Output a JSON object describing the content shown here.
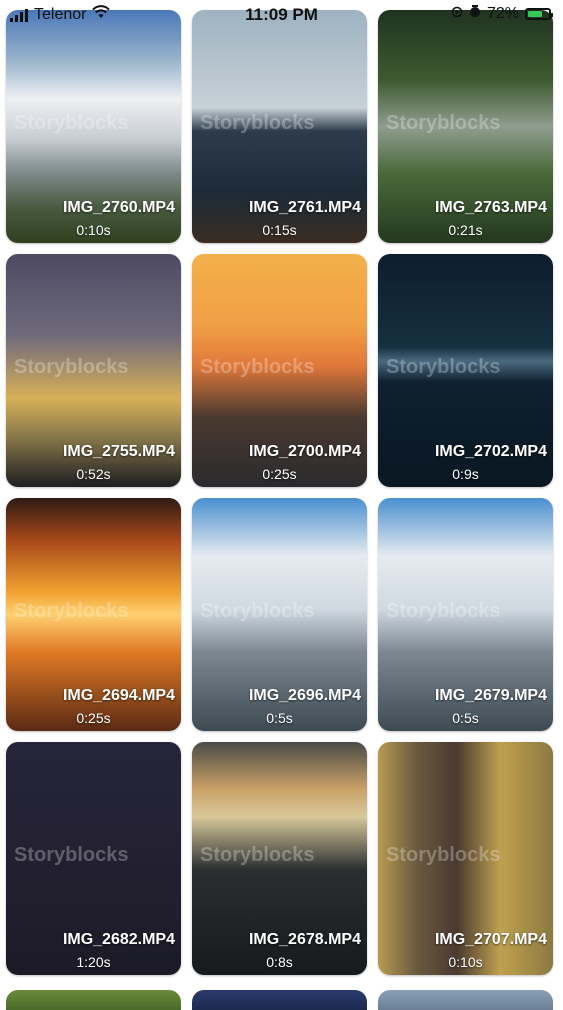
{
  "status_bar": {
    "carrier": "Telenor",
    "time": "11:09 PM",
    "battery": "72%",
    "battery_level": 0.72,
    "icons": [
      "signal-icon",
      "wifi-icon",
      "location-icon",
      "alarm-icon",
      "battery-icon"
    ]
  },
  "watermark": "Storyblocks",
  "videos": [
    {
      "name": "IMG_2760.MP4",
      "duration": "0:10s"
    },
    {
      "name": "IMG_2761.MP4",
      "duration": "0:15s"
    },
    {
      "name": "IMG_2763.MP4",
      "duration": "0:21s"
    },
    {
      "name": "IMG_2755.MP4",
      "duration": "0:52s"
    },
    {
      "name": "IMG_2700.MP4",
      "duration": "0:25s"
    },
    {
      "name": "IMG_2702.MP4",
      "duration": "0:9s"
    },
    {
      "name": "IMG_2694.MP4",
      "duration": "0:25s"
    },
    {
      "name": "IMG_2696.MP4",
      "duration": "0:5s"
    },
    {
      "name": "IMG_2679.MP4",
      "duration": "0:5s"
    },
    {
      "name": "IMG_2682.MP4",
      "duration": "1:20s"
    },
    {
      "name": "IMG_2678.MP4",
      "duration": "0:8s"
    },
    {
      "name": "IMG_2707.MP4",
      "duration": "0:10s"
    }
  ]
}
